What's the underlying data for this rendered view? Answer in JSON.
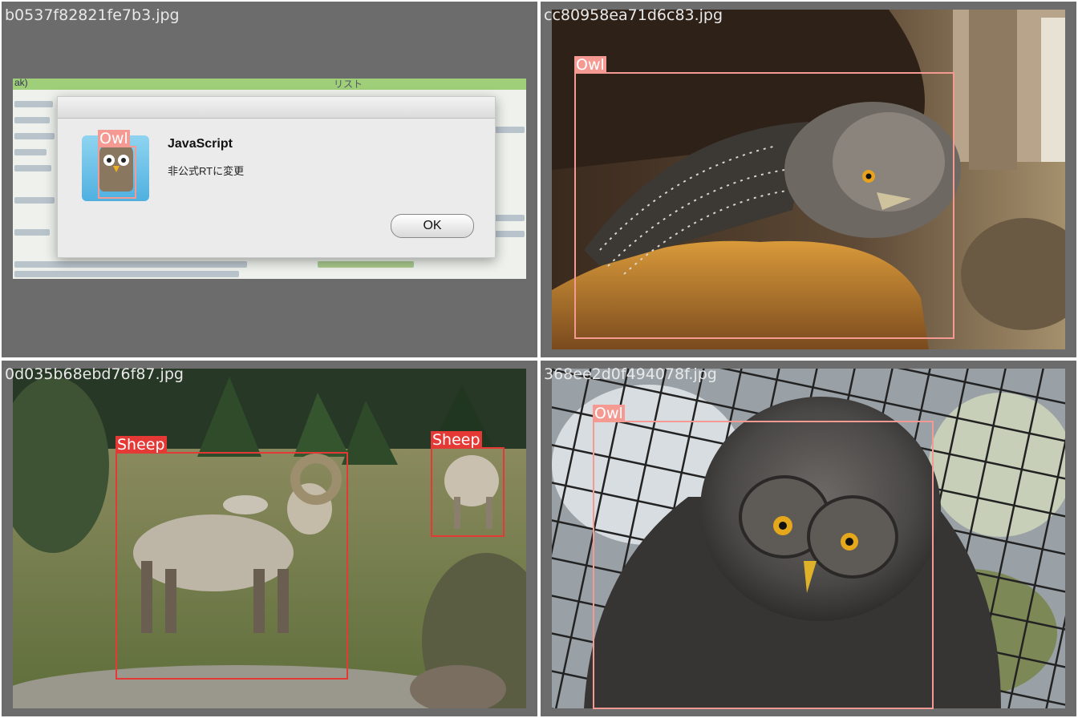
{
  "tiles": [
    {
      "filename": "b0537f82821fe7b3.jpg",
      "boxes": [
        {
          "label": "Owl"
        }
      ],
      "dialog": {
        "title": "JavaScript",
        "message": "非公式RTに変更",
        "ok_label": "OK"
      },
      "background_fragments": {
        "left": "ak)",
        "right": "リスト"
      }
    },
    {
      "filename": "cc80958ea71d6c83.jpg",
      "boxes": [
        {
          "label": "Owl"
        }
      ]
    },
    {
      "filename": "0d035b68ebd76f87.jpg",
      "boxes": [
        {
          "label": "Sheep"
        },
        {
          "label": "Sheep"
        }
      ]
    },
    {
      "filename": "368ee2d0f494078f.jpg",
      "boxes": [
        {
          "label": "Owl"
        }
      ]
    }
  ],
  "colors": {
    "owl_box": "#f59a93",
    "sheep_box": "#e53935",
    "tile_bg": "#6c6c6c"
  }
}
